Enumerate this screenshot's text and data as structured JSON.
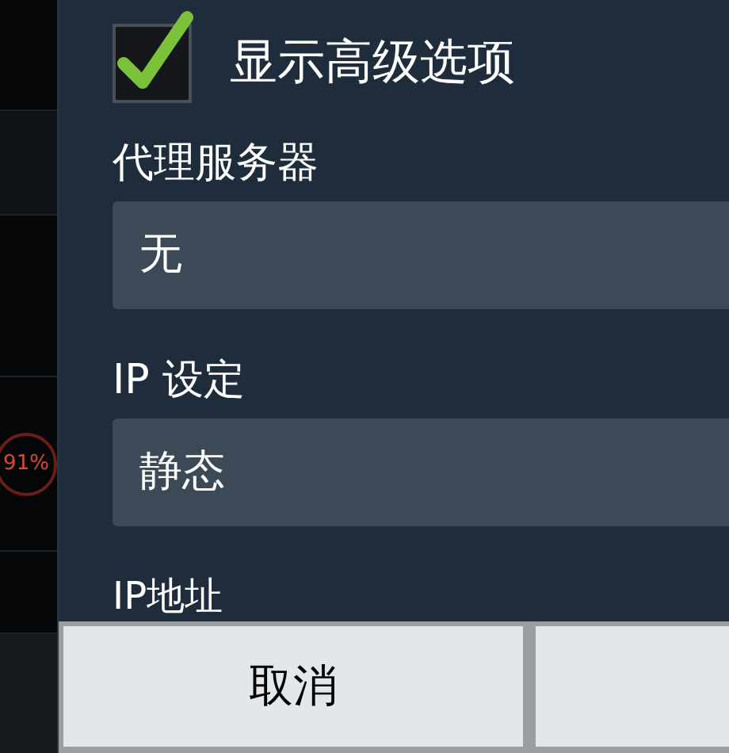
{
  "background": {
    "usage_badge": "91%"
  },
  "dialog": {
    "show_advanced": {
      "label": "显示高级选项",
      "checked": true
    },
    "fields": [
      {
        "label": "代理服务器",
        "value": "无"
      },
      {
        "label": "IP 设定",
        "value": "静态"
      }
    ],
    "next_label": "IP地址",
    "buttons": [
      "取消"
    ]
  }
}
